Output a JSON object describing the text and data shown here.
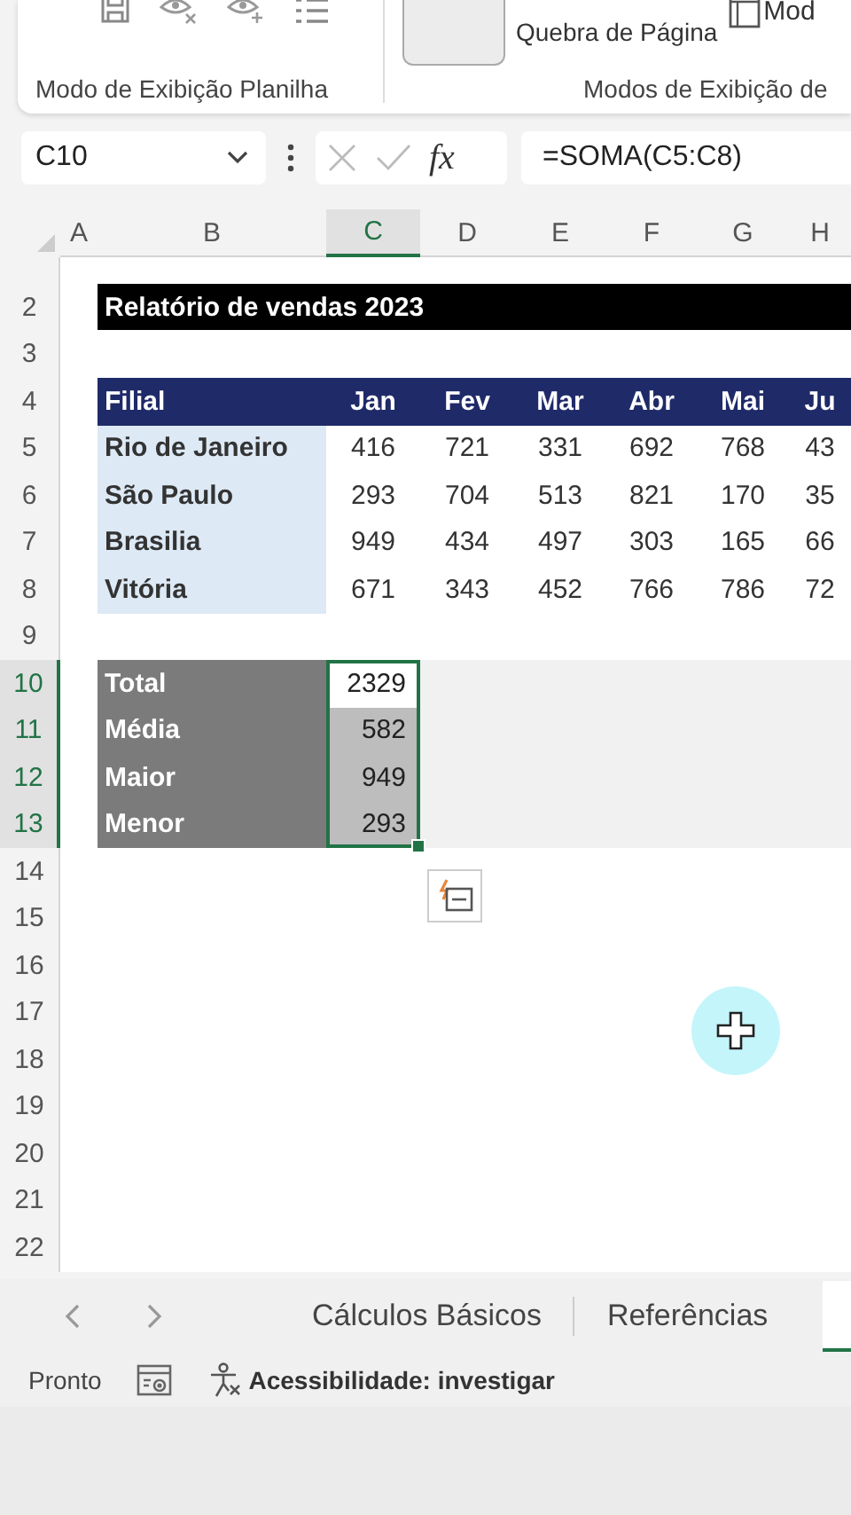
{
  "ribbon": {
    "groups": [
      {
        "label": "Modo de Exibição Planilha"
      },
      {
        "label": "Modos de Exibição de"
      }
    ],
    "buttons": [
      {
        "label": "Quebra de Página",
        "kind": "text"
      },
      {
        "label": "Mod",
        "kind": "icon-text"
      }
    ]
  },
  "formula_bar": {
    "name_box": "C10",
    "fx": "fx",
    "formula": "=SOMA(C5:C8)"
  },
  "sheet": {
    "columns": [
      {
        "label": "A",
        "selected": false
      },
      {
        "label": "B",
        "selected": false
      },
      {
        "label": "C",
        "selected": true
      },
      {
        "label": "D",
        "selected": false
      },
      {
        "label": "E",
        "selected": false
      },
      {
        "label": "F",
        "selected": false
      },
      {
        "label": "G",
        "selected": false
      },
      {
        "label": "H",
        "selected": false
      }
    ],
    "rows": [
      {
        "number": "2",
        "kind": "title",
        "selected": false,
        "cells": [
          "Relatório de vendas 2023"
        ]
      },
      {
        "number": "3",
        "kind": "blank",
        "selected": false
      },
      {
        "number": "4",
        "kind": "header",
        "selected": false,
        "cells": [
          "Filial",
          "Jan",
          "Fev",
          "Mar",
          "Abr",
          "Mai",
          "Ju"
        ]
      },
      {
        "number": "5",
        "kind": "data",
        "selected": false,
        "cells": [
          "Rio de Janeiro",
          "416",
          "721",
          "331",
          "692",
          "768",
          "43"
        ]
      },
      {
        "number": "6",
        "kind": "data",
        "selected": false,
        "cells": [
          "São Paulo",
          "293",
          "704",
          "513",
          "821",
          "170",
          "35"
        ]
      },
      {
        "number": "7",
        "kind": "data",
        "selected": false,
        "cells": [
          "Brasilia",
          "949",
          "434",
          "497",
          "303",
          "165",
          "66"
        ]
      },
      {
        "number": "8",
        "kind": "data",
        "selected": false,
        "cells": [
          "Vitória",
          "671",
          "343",
          "452",
          "766",
          "786",
          "72"
        ]
      },
      {
        "number": "9",
        "kind": "blank",
        "selected": false
      },
      {
        "number": "10",
        "kind": "summary",
        "selected": true,
        "active": true,
        "cells": [
          "Total",
          "2329"
        ]
      },
      {
        "number": "11",
        "kind": "summary",
        "selected": true,
        "active": false,
        "cells": [
          "Média",
          "582"
        ]
      },
      {
        "number": "12",
        "kind": "summary",
        "selected": true,
        "active": false,
        "cells": [
          "Maior",
          "949"
        ]
      },
      {
        "number": "13",
        "kind": "summary",
        "selected": true,
        "active": false,
        "cells": [
          "Menor",
          "293"
        ]
      },
      {
        "number": "14",
        "kind": "blank",
        "selected": false
      },
      {
        "number": "15",
        "kind": "blank",
        "selected": false
      },
      {
        "number": "16",
        "kind": "blank",
        "selected": false
      },
      {
        "number": "17",
        "kind": "blank",
        "selected": false
      },
      {
        "number": "18",
        "kind": "blank",
        "selected": false
      },
      {
        "number": "19",
        "kind": "blank",
        "selected": false
      },
      {
        "number": "20",
        "kind": "blank",
        "selected": false
      },
      {
        "number": "21",
        "kind": "blank",
        "selected": false
      },
      {
        "number": "22",
        "kind": "blank",
        "selected": false
      }
    ]
  },
  "sheet_tabs": [
    {
      "label": "Cálculos Básicos",
      "selected": false
    },
    {
      "label": "Referências",
      "selected": false
    }
  ],
  "status_bar": {
    "status": "Pronto",
    "accessibility": "Acessibilidade: investigar"
  }
}
